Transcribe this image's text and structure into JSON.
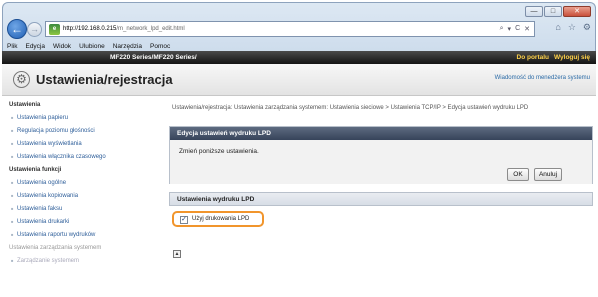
{
  "browser": {
    "window_buttons": [
      "—",
      "□",
      "✕"
    ],
    "url_host": "http://192.168.0.215",
    "url_path": "/m_network_lpd_edit.html",
    "address_tools": [
      "⌕",
      "▾",
      "C",
      "✕"
    ],
    "menu": [
      "Plik",
      "Edycja",
      "Widok",
      "Ulubione",
      "Narzędzia",
      "Pomoc"
    ]
  },
  "device": {
    "model": "MF220 Series/MF220 Series/",
    "portal_link": "Do portalu",
    "logout_link": "Wyloguj się",
    "page_title": "Ustawienia/rejestracja",
    "admin_message": "Wiadomość do menedżera systemu"
  },
  "sidebar": {
    "section1": "Ustawienia",
    "items1": [
      "Ustawienia papieru",
      "Regulacja poziomu głośności",
      "Ustawienia wyświetlania",
      "Ustawienia włącznika czasowego"
    ],
    "section2": "Ustawienia funkcji",
    "items2": [
      "Ustawienia ogólne",
      "Ustawienia kopiowania",
      "Ustawienia faksu",
      "Ustawienia drukarki",
      "Ustawienia raportu wydruków"
    ],
    "section3": "Ustawienia zarządzania systemem",
    "items3": [
      "Zarządzanie systemem"
    ]
  },
  "main": {
    "breadcrumb": "Ustawienia/rejestracja: Ustawienia zarządzania systemem: Ustawienia sieciowe > Ustawienia TCP/IP > Edycja ustawień wydruku LPD",
    "edit_panel_title": "Edycja ustawień wydruku LPD",
    "edit_note": "Zmień poniższe ustawienia.",
    "ok_label": "OK",
    "cancel_label": "Anuluj",
    "lpd_section_title": "Ustawienia wydruku LPD",
    "lpd_checkbox_label": "Użyj drukowania LPD",
    "lpd_checked": true,
    "highlight_color": "#f1952c"
  }
}
